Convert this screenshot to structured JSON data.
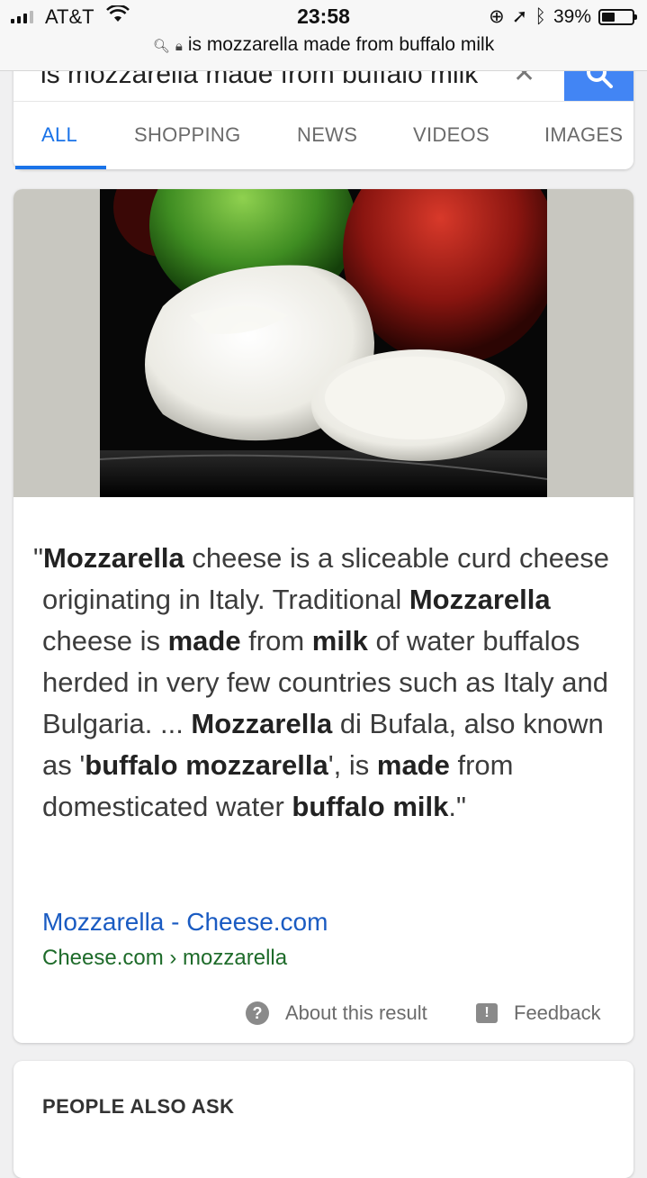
{
  "status": {
    "carrier": "AT&T",
    "time": "23:58",
    "battery": "39%",
    "battery_level": 0.39,
    "url": "is mozzarella made from buffalo milk"
  },
  "search": {
    "query": "is mozzarella made from buffalo milk",
    "accent_color": "#4285f4",
    "tabs": [
      {
        "label": "ALL",
        "active": true
      },
      {
        "label": "SHOPPING",
        "active": false
      },
      {
        "label": "NEWS",
        "active": false
      },
      {
        "label": "VIDEOS",
        "active": false
      },
      {
        "label": "IMAGES",
        "active": false
      }
    ]
  },
  "result": {
    "snippet": [
      {
        "t": "\"",
        "b": false
      },
      {
        "t": "Mozzarella",
        "b": true
      },
      {
        "t": " cheese is a sliceable curd cheese originating in Italy. Traditional ",
        "b": false
      },
      {
        "t": "Mozzarella",
        "b": true
      },
      {
        "t": " cheese is ",
        "b": false
      },
      {
        "t": "made",
        "b": true
      },
      {
        "t": " from ",
        "b": false
      },
      {
        "t": "milk",
        "b": true
      },
      {
        "t": " of water buffalos herded in very few countries such as Italy and Bulgaria. ... ",
        "b": false
      },
      {
        "t": "Mozzarella",
        "b": true
      },
      {
        "t": " di Bufala, also known as '",
        "b": false
      },
      {
        "t": "buffalo mozzarella",
        "b": true
      },
      {
        "t": "', is ",
        "b": false
      },
      {
        "t": "made",
        "b": true
      },
      {
        "t": " from domesticated water ",
        "b": false
      },
      {
        "t": "buffalo milk",
        "b": true
      },
      {
        "t": ".\"",
        "b": false
      }
    ],
    "source_title": "Mozzarella - Cheese.com",
    "source_url": "Cheese.com › mozzarella",
    "about_label": "About this result",
    "feedback_label": "Feedback",
    "link_color": "#1a5bc2",
    "url_color": "#1e6b2a"
  },
  "people_also_ask": {
    "title": "PEOPLE ALSO ASK"
  }
}
